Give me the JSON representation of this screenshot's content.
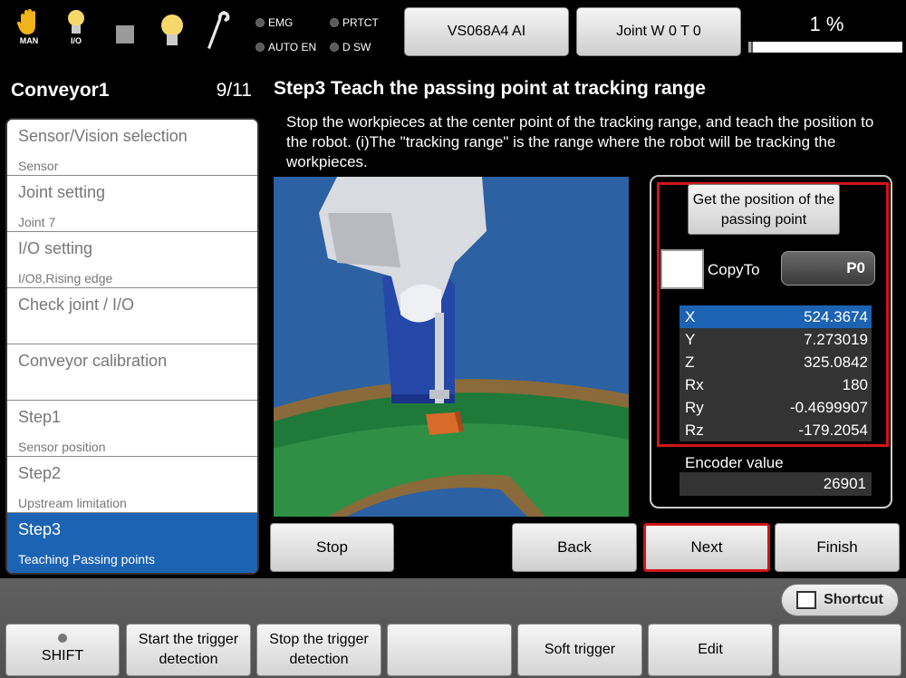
{
  "topbar": {
    "icons": [
      {
        "name": "hand-icon",
        "label": "MAN"
      },
      {
        "name": "bulb-io-icon",
        "label": "I/O"
      },
      {
        "name": "square-icon",
        "label": ""
      },
      {
        "name": "bulb-icon",
        "label": ""
      },
      {
        "name": "wrench-icon",
        "label": ""
      }
    ],
    "indicators": {
      "emg": "EMG",
      "prtct": "PRTCT",
      "auto_en": "AUTO EN",
      "dsw": "D SW"
    },
    "robot_model": "VS068A4 AI",
    "mode": "Joint  W 0 T 0",
    "speed": {
      "text": "1 %",
      "percent": 1
    }
  },
  "sidebar": {
    "title": "Conveyor1",
    "count": "9/11",
    "items": [
      {
        "label": "Sensor/Vision selection",
        "sub": "Sensor"
      },
      {
        "label": "Joint setting",
        "sub": "Joint 7"
      },
      {
        "label": "I/O setting",
        "sub": "I/O8,Rising edge"
      },
      {
        "label": "Check joint / I/O",
        "sub": ""
      },
      {
        "label": "Conveyor calibration",
        "sub": ""
      },
      {
        "label": "Step1",
        "sub": "Sensor position"
      },
      {
        "label": "Step2",
        "sub": "Upstream limitation"
      },
      {
        "label": "Step3",
        "sub": "Teaching Passing points"
      }
    ]
  },
  "main": {
    "title": "Step3 Teach the passing point at tracking range",
    "description": "Stop the workpieces at the center point of the tracking range, and teach the position to the robot. (i)The \"tracking range\" is the range where the robot will be tracking the workpieces.",
    "panel": {
      "get_position_label": "Get the position of the passing point",
      "copy_to_label": "CopyTo",
      "copy_to_point": "P0",
      "coords": [
        {
          "label": "X",
          "value": "524.3674"
        },
        {
          "label": "Y",
          "value": "7.273019"
        },
        {
          "label": "Z",
          "value": "325.0842"
        },
        {
          "label": "Rx",
          "value": "180"
        },
        {
          "label": "Ry",
          "value": "-0.4699907"
        },
        {
          "label": "Rz",
          "value": "-179.2054"
        }
      ],
      "encoder_label": "Encoder value",
      "encoder_value": "26901"
    },
    "buttons": {
      "stop": "Stop",
      "back": "Back",
      "next": "Next",
      "finish": "Finish"
    }
  },
  "bottom": {
    "shortcut": "Shortcut",
    "function_keys": [
      "SHIFT",
      "Start the trigger detection",
      "Stop the trigger detection",
      "",
      "Soft trigger",
      "Edit",
      ""
    ]
  },
  "colors": {
    "accent_blue": "#1c63b4",
    "highlight_red": "#d01616",
    "scene_blue": "#2c61a3",
    "conveyor_green": "#1f7a3a"
  }
}
